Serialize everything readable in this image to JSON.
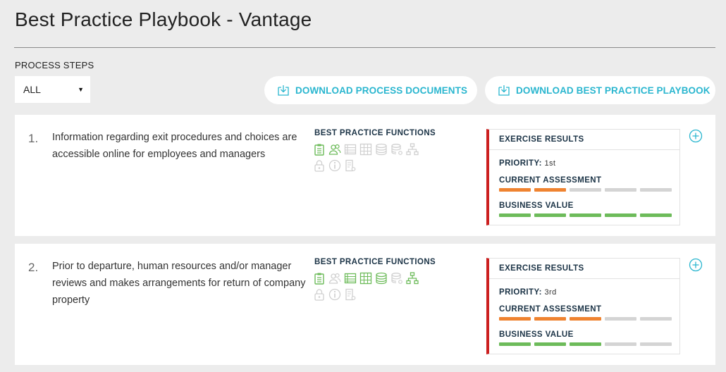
{
  "page": {
    "title": "Best Practice Playbook - Vantage"
  },
  "filter": {
    "label": "PROCESS STEPS",
    "selected": "ALL"
  },
  "buttons": {
    "download_docs": "DOWNLOAD PROCESS DOCUMENTS",
    "download_playbook": "DOWNLOAD BEST PRACTICE PLAYBOOK"
  },
  "colors": {
    "accent": "#2ab6cf",
    "green": "#6dbb5a",
    "gray_icon": "#cfcfcf",
    "orange": "#ef8330",
    "red": "#cc1f1f"
  },
  "labels": {
    "functions": "BEST PRACTICE FUNCTIONS",
    "results": "EXERCISE RESULTS",
    "priority": "PRIORITY:",
    "current": "CURRENT ASSESSMENT",
    "business": "BUSINESS VALUE"
  },
  "steps": [
    {
      "number": "1.",
      "description": "Information regarding exit procedures and choices are accessible online for employees and managers",
      "functions": [
        {
          "icon": "clipboard-icon",
          "active": true
        },
        {
          "icon": "users-icon",
          "active": true
        },
        {
          "icon": "list-icon",
          "active": false
        },
        {
          "icon": "table-icon",
          "active": false
        },
        {
          "icon": "database-icon",
          "active": false
        },
        {
          "icon": "database-settings-icon",
          "active": false
        },
        {
          "icon": "org-chart-icon",
          "active": false
        },
        {
          "icon": "lock-icon",
          "active": false
        },
        {
          "icon": "info-icon",
          "active": false
        },
        {
          "icon": "document-settings-icon",
          "active": false
        }
      ],
      "priority": "1st",
      "current_assessment": 2,
      "business_value": 5
    },
    {
      "number": "2.",
      "description": "Prior to departure, human resources and/or manager reviews and makes arrangements for return of company property",
      "functions": [
        {
          "icon": "clipboard-icon",
          "active": true
        },
        {
          "icon": "users-icon",
          "active": false
        },
        {
          "icon": "list-icon",
          "active": true
        },
        {
          "icon": "table-icon",
          "active": true
        },
        {
          "icon": "database-icon",
          "active": true
        },
        {
          "icon": "database-settings-icon",
          "active": false
        },
        {
          "icon": "org-chart-icon",
          "active": true
        },
        {
          "icon": "lock-icon",
          "active": false
        },
        {
          "icon": "info-icon",
          "active": false
        },
        {
          "icon": "document-settings-icon",
          "active": false
        }
      ],
      "priority": "3rd",
      "current_assessment": 3,
      "business_value": 3
    }
  ],
  "scale_max": 5
}
